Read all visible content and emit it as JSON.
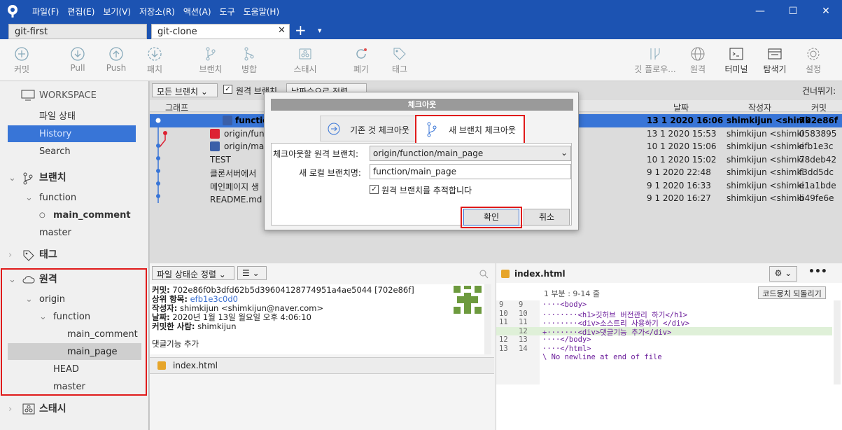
{
  "titlebar": {
    "menu": [
      "파일(F)",
      "편집(E)",
      "보기(V)",
      "저장소(R)",
      "액션(A)",
      "도구",
      "도움말(H)"
    ],
    "min": "—",
    "max": "☐",
    "close": "✕"
  },
  "tabs": [
    {
      "label": "git-first"
    },
    {
      "label": "git-clone"
    }
  ],
  "tab_close": "✕",
  "tab_add": "+",
  "tab_more": "▾",
  "toolbar": {
    "commit": "커밋",
    "pull": "Pull",
    "push": "Push",
    "fetch": "패치",
    "branch": "브랜치",
    "merge": "병합",
    "stash": "스태시",
    "discard": "폐기",
    "tag": "태그",
    "gitflow": "깃 플로우...",
    "remote": "원격",
    "terminal": "터미널",
    "explorer": "탐색기",
    "settings": "설정"
  },
  "sidebar": {
    "workspace": "WORKSPACE",
    "file_status": "파일 상태",
    "history": "History",
    "search": "Search",
    "branches": "브랜치",
    "function": "function",
    "main_comment": "main_comment",
    "master": "master",
    "tags": "태그",
    "remotes": "원격",
    "origin": "origin",
    "r_function": "function",
    "r_main_comment": "main_comment",
    "r_main_page": "main_page",
    "r_head": "HEAD",
    "r_master": "master",
    "stashes": "스태시"
  },
  "filterbar": {
    "all_branches": "모든 브랜치",
    "remote_branches": "원격 브랜치",
    "sort": "날짜순으로 정렬",
    "skip": "건너뛰기:"
  },
  "columns": {
    "graph": "그래프",
    "date": "날짜",
    "author": "작성자",
    "commit": "커밋"
  },
  "commits": [
    {
      "desc": "function",
      "date": "13 1 2020 16:06",
      "author": "shimkijun <shimk",
      "hash": "702e86f"
    },
    {
      "desc": "origin/func",
      "date": "13 1 2020 15:53",
      "author": "shimkijun <shimki",
      "hash": "0583895"
    },
    {
      "desc": "origin/mast",
      "date": "10 1 2020 15:06",
      "author": "shimkijun <shimki",
      "hash": "efb1e3c"
    },
    {
      "desc": "TEST",
      "date": "10 1 2020 15:02",
      "author": "shimkijun <shimki",
      "hash": "78deb42"
    },
    {
      "desc": "클론서버에서",
      "date": "9 1 2020 22:48",
      "author": "shimkijun <shimki",
      "hash": "f3dd5dc"
    },
    {
      "desc": "메인페이지 생",
      "date": "9 1 2020 16:33",
      "author": "shimkijun <shimki",
      "hash": "e1a1bde"
    },
    {
      "desc": "README.md 추",
      "date": "9 1 2020 16:27",
      "author": "shimkijun <shimki",
      "hash": "b49fe6e"
    }
  ],
  "details": {
    "sort": "파일 상태순 정렬",
    "commit_label": "커밋:",
    "commit_value": "702e86f0b3dfd62b5d39604128774951a4ae5044 [702e86f]",
    "parent_label": "상위 항목:",
    "parent_value": "efb1e3c0d0",
    "author_label": "작성자:",
    "author_value": "shimkijun <shimkijun@naver.com>",
    "date_label": "날짜:",
    "date_value": "2020년 1월 13일 월요일 오후 4:06:10",
    "committer_label": "커밋한 사람:",
    "committer_value": "shimkijun",
    "message": "댓글기능 추가",
    "file": "index.html"
  },
  "diff": {
    "file": "index.html",
    "hunk": "1 부분 : 9-14 줄",
    "revert": "코드뭉치 되돌리기",
    "lines": [
      {
        "o": "9",
        "n": "9",
        "text": "····<body>"
      },
      {
        "o": "10",
        "n": "10",
        "text": "········<h1>깃허브 버전관리 하기</h1>"
      },
      {
        "o": "11",
        "n": "11",
        "text": "········<div>소스트리 사용하기 </div>"
      },
      {
        "o": "",
        "n": "12",
        "text": "+·······<div>댓글기능 추가</div>"
      },
      {
        "o": "12",
        "n": "13",
        "text": "····</body>"
      },
      {
        "o": "13",
        "n": "14",
        "text": "····</html>"
      },
      {
        "o": "",
        "n": "",
        "text": "\\ No newline at end of file"
      }
    ]
  },
  "dialog": {
    "title": "체크아웃",
    "tab_existing": "기존 것 체크아웃",
    "tab_new": "새 브랜치 체크아웃",
    "remote_label": "체크아웃할 원격 브랜치:",
    "remote_value": "origin/function/main_page",
    "local_label": "새 로컬 브랜치명:",
    "local_value": "function/main_page",
    "track_label": "원격 브랜치를 추적합니다",
    "ok": "확인",
    "cancel": "취소"
  },
  "colors": {
    "titlebar": "#1c53b2",
    "selection": "#3875d7",
    "highlight": "#e01b1b",
    "diff_added": "#dff0d8"
  }
}
